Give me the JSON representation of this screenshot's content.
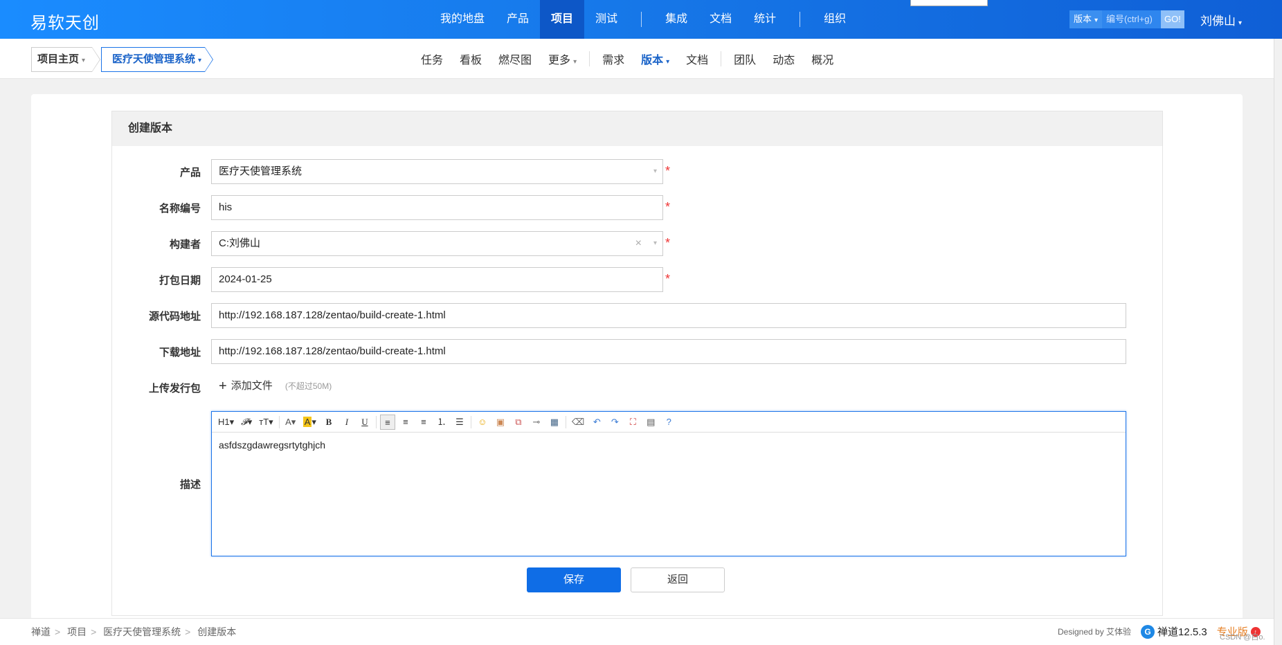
{
  "header": {
    "brand": "易软天创",
    "nav": [
      "我的地盘",
      "产品",
      "项目",
      "测试"
    ],
    "nav2": [
      "集成",
      "文档",
      "统计"
    ],
    "nav3": [
      "组织"
    ],
    "search_type": "版本",
    "search_placeholder": "编号(ctrl+g)",
    "search_go": "GO!",
    "user": "刘佛山"
  },
  "subheader": {
    "crumb_home": "项目主页",
    "crumb_project": "医疗天使管理系统",
    "nav": [
      "任务",
      "看板",
      "燃尽图",
      "更多"
    ],
    "nav2": [
      "需求",
      "版本",
      "文档"
    ],
    "nav3": [
      "团队",
      "动态",
      "概况"
    ]
  },
  "form": {
    "title": "创建版本",
    "product_label": "产品",
    "product_value": "医疗天使管理系统",
    "name_label": "名称编号",
    "name_value": "his",
    "builder_label": "构建者",
    "builder_value": "C:刘佛山",
    "date_label": "打包日期",
    "date_value": "2024-01-25",
    "scm_label": "源代码地址",
    "scm_value": "http://192.168.187.128/zentao/build-create-1.html",
    "download_label": "下载地址",
    "download_value": "http://192.168.187.128/zentao/build-create-1.html",
    "upload_label": "上传发行包",
    "upload_add": "添加文件",
    "upload_hint": "(不超过50M)",
    "desc_label": "描述",
    "desc_value": "asfdszgdawregsrtytghjch",
    "save": "保存",
    "back": "返回",
    "required_mark": "*"
  },
  "footer": {
    "crumbs": [
      "禅道",
      "项目",
      "医疗天使管理系统",
      "创建版本"
    ],
    "designed": "Designed by 艾体验",
    "version": "禅道12.5.3",
    "pro": "专业版",
    "watermark": "CSDN @白o."
  }
}
